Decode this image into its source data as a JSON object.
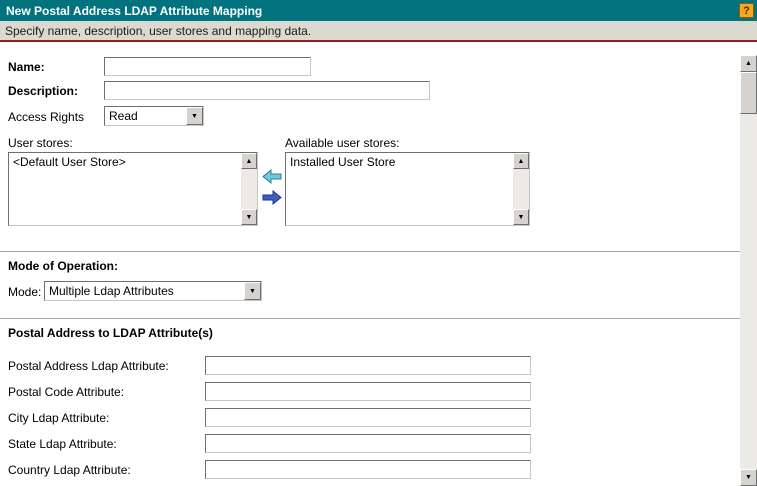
{
  "window": {
    "title": "New Postal Address LDAP Attribute Mapping",
    "subtitle": "Specify name, description, user stores and mapping data.",
    "help_icon": "?"
  },
  "colors": {
    "header_bg": "#00737F",
    "subtitle_bg": "#DCD9D1",
    "subtitle_rule": "#9E1B1B",
    "help_bg": "#F6A821",
    "scrollbar_face": "#D6D3CE",
    "move_left_arrow": "#6FC9DE",
    "move_right_arrow": "#3E5FBF"
  },
  "form": {
    "name": {
      "label": "Name:",
      "value": ""
    },
    "description": {
      "label": "Description:",
      "value": ""
    },
    "access_rights": {
      "label": "Access Rights",
      "value": "Read"
    },
    "user_stores": {
      "label": "User stores:",
      "items": [
        "<Default User Store>"
      ]
    },
    "available_user_stores": {
      "label": "Available user stores:",
      "items": [
        "Installed User Store"
      ]
    }
  },
  "mode_section": {
    "heading": "Mode of Operation:",
    "mode": {
      "label": "Mode:",
      "value": "Multiple Ldap Attributes"
    }
  },
  "mapping_section": {
    "heading": "Postal Address to LDAP Attribute(s)",
    "fields": [
      {
        "label": "Postal Address Ldap Attribute:",
        "value": ""
      },
      {
        "label": "Postal Code Attribute:",
        "value": ""
      },
      {
        "label": "City Ldap Attribute:",
        "value": ""
      },
      {
        "label": "State Ldap Attribute:",
        "value": ""
      },
      {
        "label": "Country Ldap Attribute:",
        "value": ""
      }
    ]
  },
  "icons": {
    "scroll_up": "▲",
    "scroll_down": "▼",
    "dropdown": "▼"
  }
}
